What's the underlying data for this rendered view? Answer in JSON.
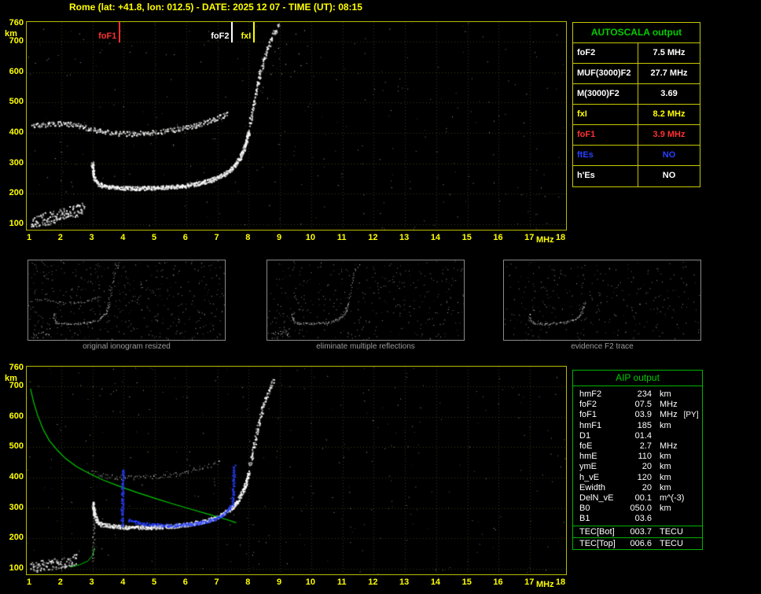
{
  "header": {
    "title": "Rome (lat: +41.8, lon: 012.5) - DATE: 2025 12 07 - TIME (UT): 08:15"
  },
  "colors": {
    "axis_yellow": "#ffff00",
    "frame_yellow": "#b8b800",
    "green": "#00cc00",
    "red": "#ff3030",
    "blue": "#2840ff",
    "caption_gray": "#9a9a9a"
  },
  "autoscala_table": {
    "title": "AUTOSCALA output",
    "rows": [
      {
        "label": "foF2",
        "value": "7.5 MHz",
        "color": "#ffffff"
      },
      {
        "label": "MUF(3000)F2",
        "value": "27.7 MHz",
        "color": "#ffffff"
      },
      {
        "label": "M(3000)F2",
        "value": "3.69",
        "color": "#ffffff"
      },
      {
        "label": "fxI",
        "value": "8.2 MHz",
        "color": "#ffff00"
      },
      {
        "label": "foF1",
        "value": "3.9 MHz",
        "color": "#ff3030"
      },
      {
        "label": "ftEs",
        "value": "NO",
        "color": "#2840ff"
      },
      {
        "label": "h'Es",
        "value": "NO",
        "color": "#ffffff"
      }
    ]
  },
  "aip_table": {
    "title": "AIP output",
    "rows": [
      {
        "label": "hmF2",
        "value": "234",
        "unit": "km",
        "note": ""
      },
      {
        "label": "foF2",
        "value": "07.5",
        "unit": "MHz",
        "note": ""
      },
      {
        "label": "foF1",
        "value": "03.9",
        "unit": "MHz",
        "note": "[PY]"
      },
      {
        "label": "hmF1",
        "value": "185",
        "unit": "km",
        "note": ""
      },
      {
        "label": "D1",
        "value": "01.4",
        "unit": "",
        "note": ""
      },
      {
        "label": "foE",
        "value": "2.7",
        "unit": "MHz",
        "note": ""
      },
      {
        "label": "hmE",
        "value": "110",
        "unit": "km",
        "note": ""
      },
      {
        "label": "ymE",
        "value": "20",
        "unit": "km",
        "note": ""
      },
      {
        "label": "h_vE",
        "value": "120",
        "unit": "km",
        "note": ""
      },
      {
        "label": "Ewidth",
        "value": "20",
        "unit": "km",
        "note": ""
      },
      {
        "label": "DelN_vE",
        "value": "00.1",
        "unit": "m^(-3)",
        "note": ""
      },
      {
        "label": "B0",
        "value": "050.0",
        "unit": "km",
        "note": ""
      },
      {
        "label": "B1",
        "value": "03.6",
        "unit": "",
        "note": ""
      }
    ],
    "tec_rows": [
      {
        "label": "TEC[Bot]",
        "value": "003.7",
        "unit": "TECU"
      },
      {
        "label": "TEC[Top]",
        "value": "006.6",
        "unit": "TECU"
      }
    ]
  },
  "thumbnails": [
    {
      "caption": "original ionogram resized",
      "include": [
        "es-cluster",
        "f-trace",
        "f-second-hop",
        "x-rise"
      ],
      "noise": 500
    },
    {
      "caption": "eliminate multiple reflections",
      "include": [
        "es-cluster",
        "f-trace",
        "x-rise"
      ],
      "noise": 380
    },
    {
      "caption": "evidence F2 trace",
      "include": [
        "f-trace"
      ],
      "noise": 300
    }
  ],
  "chart_data": [
    {
      "name": "scaled ionogram",
      "type": "scatter",
      "xlim": [
        1,
        18
      ],
      "ylim": [
        100,
        760
      ],
      "x_unit": "MHz",
      "y_unit": "km",
      "xticks": [
        1,
        2,
        3,
        4,
        5,
        6,
        7,
        8,
        9,
        10,
        11,
        12,
        13,
        14,
        15,
        16,
        17,
        18
      ],
      "yticks": [
        760,
        700,
        600,
        500,
        400,
        300,
        200,
        100
      ],
      "grid": true,
      "noise": 280,
      "markers": [
        {
          "label": "foF1",
          "x": 3.9,
          "color": "#ff3030"
        },
        {
          "label": "foF2",
          "x": 7.5,
          "color": "#ffffff"
        },
        {
          "label": "fxI",
          "x": 8.2,
          "color": "#ffff00"
        }
      ],
      "traces": [
        {
          "name": "es-cluster",
          "color": "#ffffff",
          "style": "dots",
          "size": 2,
          "jitter": 8,
          "density": 1.8,
          "points": [
            [
              1.0,
              112
            ],
            [
              1.3,
              116
            ],
            [
              1.6,
              122
            ],
            [
              1.9,
              129
            ],
            [
              2.2,
              137
            ],
            [
              2.5,
              147
            ],
            [
              2.72,
              158
            ]
          ]
        },
        {
          "name": "f-trace",
          "color": "#ffffff",
          "style": "dots",
          "size": 2,
          "jitter": 2.5,
          "density": 2.6,
          "points": [
            [
              2.98,
              305
            ],
            [
              3.03,
              260
            ],
            [
              3.12,
              240
            ],
            [
              3.28,
              229
            ],
            [
              3.55,
              224
            ],
            [
              4.0,
              221
            ],
            [
              4.5,
              220
            ],
            [
              5.0,
              221
            ],
            [
              5.5,
              224
            ],
            [
              6.0,
              229
            ],
            [
              6.4,
              236
            ],
            [
              6.8,
              247
            ],
            [
              7.1,
              260
            ],
            [
              7.35,
              276
            ],
            [
              7.55,
              295
            ],
            [
              7.7,
              318
            ],
            [
              7.82,
              346
            ],
            [
              7.92,
              378
            ],
            [
              7.99,
              408
            ]
          ]
        },
        {
          "name": "f-second-hop",
          "color": "#ffffff",
          "style": "dots",
          "size": 2,
          "jitter": 3,
          "density": 1.1,
          "points": [
            [
              1.05,
              424
            ],
            [
              1.5,
              430
            ],
            [
              2.0,
              432
            ],
            [
              2.45,
              429
            ],
            [
              2.85,
              417
            ],
            [
              3.25,
              407
            ],
            [
              3.7,
              401
            ],
            [
              4.2,
              399
            ],
            [
              4.7,
              401
            ],
            [
              5.2,
              406
            ],
            [
              5.7,
              414
            ],
            [
              6.2,
              424
            ],
            [
              6.7,
              439
            ],
            [
              7.05,
              453
            ],
            [
              7.3,
              468
            ]
          ]
        },
        {
          "name": "x-rise",
          "color": "#ffffff",
          "style": "dots",
          "size": 2,
          "jitter": 3.5,
          "density": 1.0,
          "points": [
            [
              8.02,
              428
            ],
            [
              8.1,
              476
            ],
            [
              8.2,
              526
            ],
            [
              8.3,
              576
            ],
            [
              8.42,
              626
            ],
            [
              8.58,
              676
            ],
            [
              8.75,
              720
            ],
            [
              8.95,
              752
            ]
          ]
        },
        {
          "name": "topside-spread",
          "color": "#ffffff",
          "style": "dots",
          "size": 1,
          "jitter": 28,
          "density": 0.22,
          "points": [
            [
              8.35,
              560
            ],
            [
              8.8,
              600
            ],
            [
              9.3,
              650
            ],
            [
              9.9,
              700
            ]
          ]
        }
      ]
    },
    {
      "name": "AIP restored ionogram with profile",
      "type": "scatter",
      "xlim": [
        1,
        18
      ],
      "ylim": [
        100,
        760
      ],
      "x_unit": "MHz",
      "y_unit": "km",
      "xticks": [
        1,
        2,
        3,
        4,
        5,
        6,
        7,
        8,
        9,
        10,
        11,
        12,
        13,
        14,
        15,
        16,
        17,
        18
      ],
      "yticks": [
        760,
        700,
        600,
        500,
        400,
        300,
        200,
        100
      ],
      "grid": true,
      "noise": 300,
      "markers": [],
      "traces": [
        {
          "name": "es-cluster",
          "color": "#ffffff",
          "style": "dots",
          "size": 2,
          "jitter": 7,
          "density": 1.5,
          "points": [
            [
              1.0,
              108
            ],
            [
              1.4,
              112
            ],
            [
              1.8,
              118
            ],
            [
              2.2,
              126
            ],
            [
              2.5,
              134
            ]
          ]
        },
        {
          "name": "es-profile-green",
          "color": "#00cc00",
          "style": "line",
          "width": 1,
          "points": [
            [
              2.3,
              106
            ],
            [
              2.6,
              114
            ],
            [
              2.85,
              126
            ],
            [
              3.0,
              144
            ],
            [
              3.06,
              168
            ]
          ]
        },
        {
          "name": "e-spike",
          "color": "#ffffff",
          "style": "dots",
          "size": 1,
          "jitter": 2,
          "density": 0.8,
          "points": [
            [
              3.02,
              128
            ],
            [
              3.05,
              300
            ]
          ]
        },
        {
          "name": "f-trace",
          "color": "#ffffff",
          "style": "dots",
          "size": 2,
          "jitter": 2.5,
          "density": 2.4,
          "points": [
            [
              3.0,
              320
            ],
            [
              3.05,
              278
            ],
            [
              3.15,
              258
            ],
            [
              3.3,
              247
            ],
            [
              3.6,
              242
            ],
            [
              4.0,
              239
            ],
            [
              4.5,
              238
            ],
            [
              5.0,
              239
            ],
            [
              5.5,
              242
            ],
            [
              6.0,
              247
            ],
            [
              6.4,
              254
            ],
            [
              6.8,
              265
            ],
            [
              7.1,
              278
            ],
            [
              7.35,
              294
            ],
            [
              7.55,
              313
            ],
            [
              7.7,
              336
            ],
            [
              7.82,
              362
            ],
            [
              7.92,
              392
            ],
            [
              7.99,
              420
            ]
          ]
        },
        {
          "name": "f-second-hop",
          "color": "#ffffff",
          "style": "dots",
          "size": 1,
          "jitter": 3,
          "density": 0.7,
          "points": [
            [
              2.85,
              420
            ],
            [
              3.3,
              408
            ],
            [
              3.8,
              401
            ],
            [
              4.3,
              399
            ],
            [
              4.8,
              402
            ],
            [
              5.3,
              407
            ],
            [
              5.8,
              415
            ],
            [
              6.3,
              426
            ],
            [
              6.8,
              441
            ],
            [
              7.1,
              455
            ]
          ]
        },
        {
          "name": "x-rise",
          "color": "#ffffff",
          "style": "dots",
          "size": 2,
          "jitter": 3.5,
          "density": 0.9,
          "points": [
            [
              8.02,
              440
            ],
            [
              8.12,
              488
            ],
            [
              8.22,
              538
            ],
            [
              8.32,
              588
            ],
            [
              8.45,
              638
            ],
            [
              8.6,
              685
            ],
            [
              8.78,
              725
            ]
          ]
        },
        {
          "name": "profile-green",
          "color": "#00cc00",
          "style": "line",
          "width": 1.2,
          "points": [
            [
              1.02,
              692
            ],
            [
              1.12,
              648
            ],
            [
              1.25,
              604
            ],
            [
              1.42,
              560
            ],
            [
              1.62,
              522
            ],
            [
              1.88,
              490
            ],
            [
              2.15,
              462
            ],
            [
              2.5,
              436
            ],
            [
              2.9,
              414
            ],
            [
              3.35,
              392
            ],
            [
              3.85,
              372
            ],
            [
              4.4,
              352
            ],
            [
              5.0,
              332
            ],
            [
              5.6,
              313
            ],
            [
              6.2,
              295
            ],
            [
              6.8,
              277
            ],
            [
              7.3,
              262
            ],
            [
              7.6,
              252
            ]
          ]
        },
        {
          "name": "restored-trace-blue",
          "color": "#2840ff",
          "style": "dots",
          "size": 2,
          "jitter": 2,
          "density": 1.6,
          "points": [
            [
              4.15,
              262
            ],
            [
              4.5,
              252
            ],
            [
              5.0,
              246
            ],
            [
              5.5,
              244
            ],
            [
              6.0,
              247
            ],
            [
              6.4,
              253
            ],
            [
              6.8,
              263
            ],
            [
              7.1,
              275
            ],
            [
              7.3,
              290
            ],
            [
              7.42,
              310
            ]
          ]
        },
        {
          "name": "foF1-cusp-blue",
          "color": "#2840ff",
          "style": "dots",
          "size": 2,
          "jitter": 1.5,
          "density": 1.3,
          "points": [
            [
              3.93,
              238
            ],
            [
              3.97,
              428
            ]
          ]
        },
        {
          "name": "foF2-cusp-blue",
          "color": "#2840ff",
          "style": "dots",
          "size": 2,
          "jitter": 1.5,
          "density": 1.3,
          "points": [
            [
              7.48,
              312
            ],
            [
              7.52,
              440
            ]
          ]
        }
      ]
    }
  ]
}
